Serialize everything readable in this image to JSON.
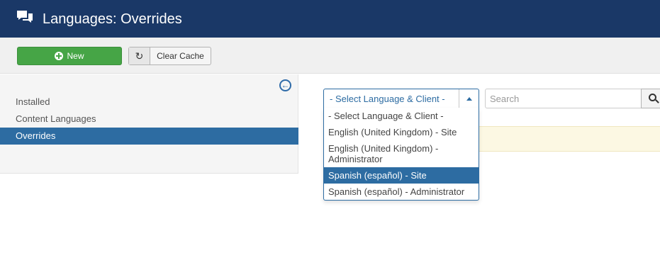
{
  "header": {
    "title": "Languages: Overrides",
    "icon": "comments-icon"
  },
  "toolbar": {
    "new_label": "New",
    "clear_cache_label": "Clear Cache"
  },
  "sidebar": {
    "items": [
      {
        "label": "Installed",
        "active": false
      },
      {
        "label": "Content Languages",
        "active": false
      },
      {
        "label": "Overrides",
        "active": true
      }
    ]
  },
  "filter": {
    "selected": "- Select Language & Client -",
    "options": [
      "- Select Language & Client -",
      "English (United Kingdom) - Site",
      "English (United Kingdom) - Administrator",
      "Spanish (español) - Site",
      "Spanish (español) - Administrator"
    ],
    "highlighted_option": "Spanish (español) - Site"
  },
  "search": {
    "placeholder": "Search"
  },
  "colors": {
    "header_bg": "#1a3867",
    "accent": "#2d6ca2",
    "new_button": "#46a546",
    "notice_bg": "#fcf8e3"
  }
}
